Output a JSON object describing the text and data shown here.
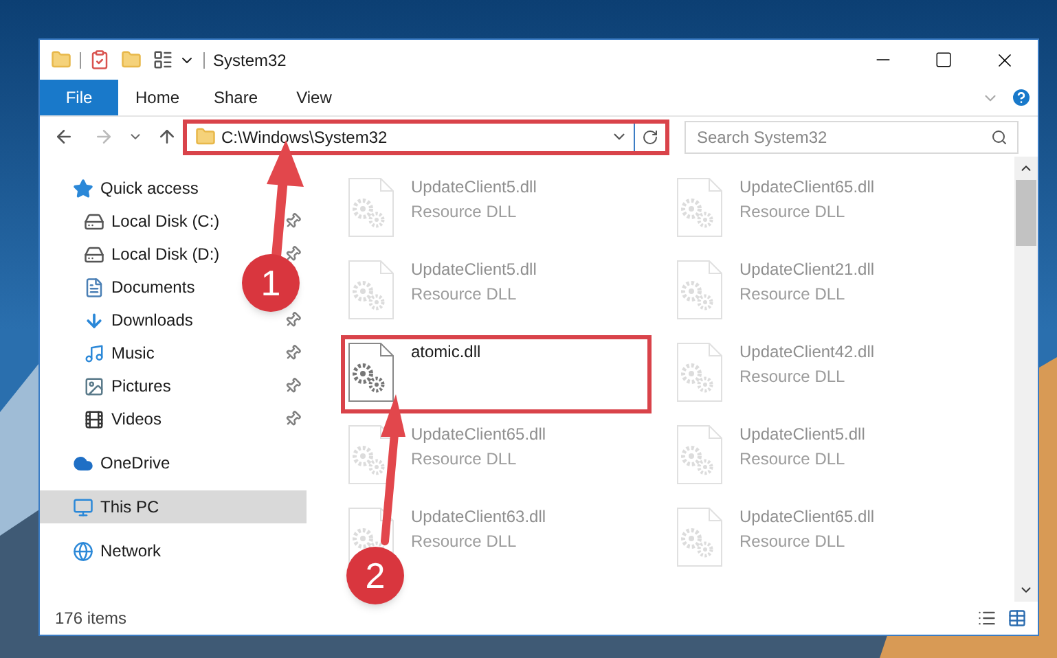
{
  "window": {
    "title": "System32"
  },
  "ribbon": {
    "tabs": [
      {
        "label": "File",
        "kind": "file",
        "selected": false
      },
      {
        "label": "Home",
        "kind": "tab",
        "selected": false
      },
      {
        "label": "Share",
        "kind": "tab",
        "selected": false
      },
      {
        "label": "View",
        "kind": "tab",
        "selected": false
      }
    ]
  },
  "address": {
    "path": "C:\\Windows\\System32",
    "highlighted": true
  },
  "search": {
    "placeholder": "Search System32"
  },
  "sidebar": {
    "items": [
      {
        "label": "Quick access",
        "kind": "star",
        "selected": false,
        "children": [
          {
            "label": "Local Disk (C:)",
            "kind": "drive",
            "pinned": true,
            "selected": false
          },
          {
            "label": "Local Disk (D:)",
            "kind": "drive",
            "pinned": true,
            "selected": false
          },
          {
            "label": "Documents",
            "kind": "documents",
            "pinned": false,
            "selected": false
          },
          {
            "label": "Downloads",
            "kind": "downloads",
            "pinned": true,
            "selected": false
          },
          {
            "label": "Music",
            "kind": "music",
            "pinned": true,
            "selected": false
          },
          {
            "label": "Pictures",
            "kind": "pictures",
            "pinned": true,
            "selected": false
          },
          {
            "label": "Videos",
            "kind": "videos",
            "pinned": true,
            "selected": false
          }
        ]
      },
      {
        "label": "OneDrive",
        "kind": "cloud",
        "selected": false
      },
      {
        "label": "This PC",
        "kind": "pc",
        "selected": true
      },
      {
        "label": "Network",
        "kind": "network",
        "selected": false
      }
    ]
  },
  "files": [
    {
      "name": "UpdateClient5.dll",
      "type": "Resource DLL",
      "faded": true,
      "highlighted": false
    },
    {
      "name": "UpdateClient65.dll",
      "type": "Resource DLL",
      "faded": true,
      "highlighted": false
    },
    {
      "name": "UpdateClient5.dll",
      "type": "Resource DLL",
      "faded": true,
      "highlighted": false
    },
    {
      "name": "UpdateClient21.dll",
      "type": "Resource DLL",
      "faded": true,
      "highlighted": false
    },
    {
      "name": "atomic.dll",
      "faded": false,
      "highlighted": true
    },
    {
      "name": "UpdateClient42.dll",
      "type": "Resource DLL",
      "faded": true,
      "highlighted": false
    },
    {
      "name": "UpdateClient65.dll",
      "type": "Resource DLL",
      "faded": true,
      "highlighted": false
    },
    {
      "name": "UpdateClient5.dll",
      "type": "Resource DLL",
      "faded": true,
      "highlighted": false
    },
    {
      "name": "UpdateClient63.dll",
      "type": "Resource DLL",
      "faded": true,
      "highlighted": false
    },
    {
      "name": "UpdateClient65.dll",
      "type": "Resource DLL",
      "faded": true,
      "highlighted": false
    }
  ],
  "status_bar": {
    "count": "176 items"
  },
  "callouts": [
    {
      "number": "1"
    },
    {
      "number": "2"
    }
  ]
}
